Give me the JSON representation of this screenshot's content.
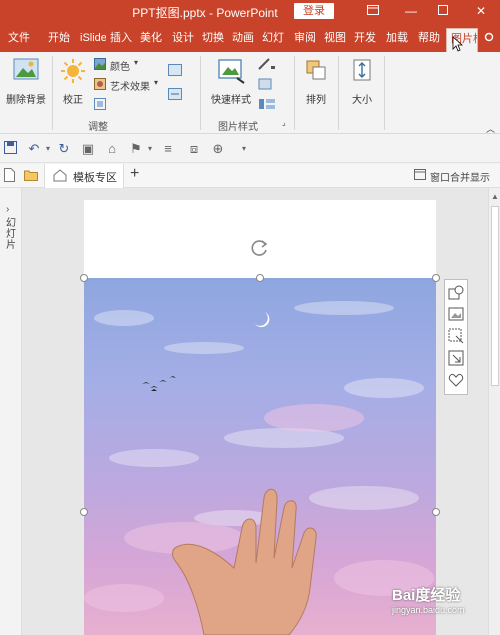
{
  "titlebar": {
    "title": "PPT抠图.pptx - PowerPoint",
    "login": "登录",
    "accent": "#c9432a"
  },
  "tabs": [
    "文件",
    "开始",
    "iSlide",
    "插入",
    "美化",
    "设计",
    "切换",
    "动画",
    "幻灯",
    "审阅",
    "视图",
    "开发",
    "加载",
    "帮助",
    "图片格"
  ],
  "ribbon": {
    "remove_bg": "删除背景",
    "correct": "校正",
    "color": "颜色",
    "art_effects": "艺术效果",
    "group_adjust": "调整",
    "quick_styles": "快速样式",
    "group_picture_styles": "图片样式",
    "arrange": "排列",
    "size": "大小"
  },
  "doctabs": {
    "template_zone": "模板专区",
    "add": "+",
    "merge_window": "窗口合并显示"
  },
  "leftpane": {
    "label": "幻灯片"
  },
  "watermark": {
    "main": "Bai度经验",
    "sub": "jingyan.baidu.com"
  }
}
